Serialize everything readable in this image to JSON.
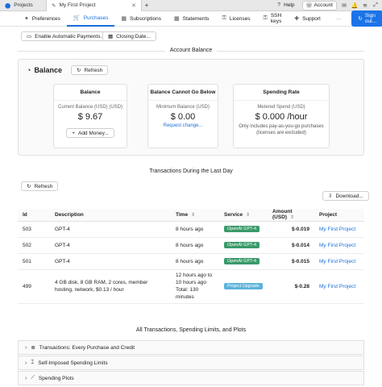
{
  "browser": {
    "tabs": [
      {
        "label": "Projects"
      },
      {
        "label": "My First Project"
      }
    ],
    "help_label": "Help",
    "account_label": "Account"
  },
  "nav": {
    "items": [
      "Preferences",
      "Purchases",
      "Subscriptions",
      "Statements",
      "Licenses",
      "SSH keys",
      "Support"
    ],
    "active": "Purchases",
    "signout_label": "Sign out..."
  },
  "actions": {
    "enable_auto_payments": "Enable Automatic Payments...",
    "closing_date": "Closing Date..."
  },
  "account_balance": {
    "section_title": "Account Balance",
    "balance_heading": "Balance",
    "refresh_label": "Refresh",
    "cards": {
      "balance": {
        "title": "Balance",
        "label": "Current Balance (USD) (USD)",
        "value": "$ 9.67",
        "button": "Add Money..."
      },
      "min": {
        "title": "Balance Cannot Go Below",
        "label": "Minimum Balance (USD)",
        "value": "$ 0.00",
        "link": "Request change..."
      },
      "rate": {
        "title": "Spending Rate",
        "label": "Metered Spend (USD)",
        "value": "$ 0.000 /hour",
        "note": "Only includes pay-as-you-go purchases (licenses are excluded)"
      }
    }
  },
  "transactions": {
    "section_title": "Transactions During the Last Day",
    "refresh_label": "Refresh",
    "download_label": "Download...",
    "columns": [
      "Id",
      "Description",
      "Time",
      "Service",
      "Amount (USD)",
      "Project"
    ],
    "rows": [
      {
        "id": "503",
        "description": "GPT-4",
        "time": "8 hours ago",
        "service": "OpenAI GPT-4",
        "amount": "$-0.019",
        "project": "My First Project"
      },
      {
        "id": "502",
        "description": "GPT-4",
        "time": "8 hours ago",
        "service": "OpenAI GPT-4",
        "amount": "$-0.014",
        "project": "My First Project"
      },
      {
        "id": "501",
        "description": "GPT-4",
        "time": "8 hours ago",
        "service": "OpenAI GPT-4",
        "amount": "$-0.015",
        "project": "My First Project"
      },
      {
        "id": "499",
        "description": "4 GB disk, 8 GB RAM, 2 cores, member hosting, network, $0.13 / hour",
        "time": "12 hours ago to 10 hours ago Total: 130 minutes",
        "service": "Project Upgrade",
        "amount": "$-0.28",
        "project": "My First Project"
      }
    ]
  },
  "all_transactions": {
    "section_title": "All Transactions, Spending Limits, and Plots",
    "panels": [
      "Transactions: Every Purchase and Credit",
      "Self-Imposed Spending Limits",
      "Spending Plots"
    ]
  },
  "colors": {
    "accent": "#1a73e8",
    "badge_green": "#3a9a6a",
    "badge_blue": "#5cb3d9"
  }
}
